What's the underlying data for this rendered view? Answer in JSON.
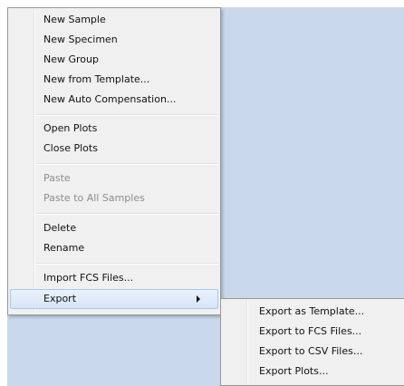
{
  "context_menu": {
    "items": [
      {
        "label": "New Sample"
      },
      {
        "label": "New Specimen"
      },
      {
        "label": "New Group"
      },
      {
        "label": "New from Template..."
      },
      {
        "label": "New Auto Compensation..."
      },
      {
        "label": "Open Plots"
      },
      {
        "label": "Close Plots"
      },
      {
        "label": "Paste",
        "disabled": true
      },
      {
        "label": "Paste to All Samples",
        "disabled": true
      },
      {
        "label": "Delete"
      },
      {
        "label": "Rename"
      },
      {
        "label": "Import FCS Files..."
      },
      {
        "label": "Export",
        "highlighted": true,
        "has_submenu": true
      }
    ]
  },
  "export_submenu": {
    "items": [
      {
        "label": "Export as Template..."
      },
      {
        "label": "Export to FCS Files..."
      },
      {
        "label": "Export to CSV Files..."
      },
      {
        "label": "Export Plots..."
      }
    ]
  },
  "colors": {
    "background": "#c8d8ea",
    "menu_background": "#f0f0f0",
    "highlight_border": "#a9c7ec",
    "disabled_text": "#8d8d8d"
  }
}
